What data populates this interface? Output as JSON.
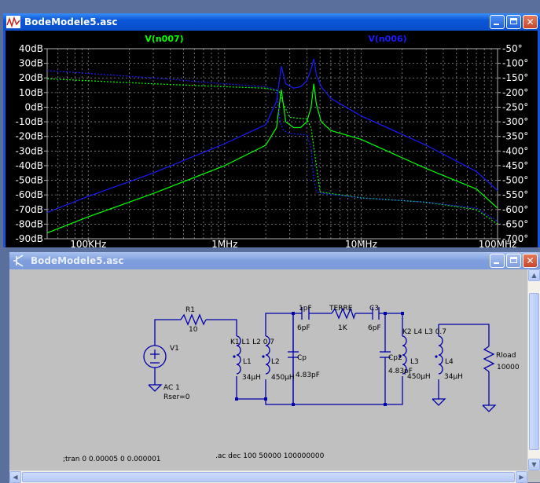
{
  "plot_window": {
    "title": "BodeModele5.asc",
    "trace1_name": "V(n007)",
    "trace2_name": "V(n006)",
    "trace1_color": "#00ff00",
    "trace2_color": "#1a1aff",
    "background": "#000000",
    "left_axis_ticks": [
      "40dB",
      "30dB",
      "20dB",
      "10dB",
      "0dB",
      "-10dB",
      "-20dB",
      "-30dB",
      "-40dB",
      "-50dB",
      "-60dB",
      "-70dB",
      "-80dB",
      "-90dB"
    ],
    "right_axis_ticks": [
      "-50°",
      "-100°",
      "-150°",
      "-200°",
      "-250°",
      "-300°",
      "-350°",
      "-400°",
      "-450°",
      "-500°",
      "-550°",
      "-600°",
      "-650°",
      "-700°"
    ],
    "x_axis_ticks": [
      "100KHz",
      "1MHz",
      "10MHz",
      "100MHz"
    ]
  },
  "chart_data": {
    "type": "line",
    "x_scale": "log",
    "xlim": [
      50000,
      100000000
    ],
    "ylim_left": [
      -90,
      40
    ],
    "ylim_right": [
      -700,
      -50
    ],
    "grid": true,
    "series": [
      {
        "name": "V(n007)",
        "kind": "magnitude",
        "axis": "left",
        "style": "solid",
        "x": [
          50000,
          100000,
          300000,
          1000000,
          2000000,
          2400000,
          2600000,
          2800000,
          3200000,
          3600000,
          4000000,
          4300000,
          4500000,
          4700000,
          5100000,
          6000000,
          10000000,
          30000000,
          70000000,
          100000000
        ],
        "y": [
          -86,
          -75,
          -59,
          -40,
          -26,
          -14,
          12,
          -10,
          -14,
          -14,
          -10,
          0,
          16,
          2,
          -10,
          -16,
          -22,
          -42,
          -56,
          -69
        ]
      },
      {
        "name": "V(n007)",
        "kind": "phase",
        "axis": "right",
        "style": "dashed",
        "x": [
          50000,
          300000,
          1000000,
          2000000,
          2500000,
          2700000,
          3000000,
          4000000,
          4300000,
          4600000,
          5000000,
          10000000,
          30000000,
          70000000,
          100000000
        ],
        "y": [
          -153,
          -170,
          -180,
          -185,
          -195,
          -240,
          -285,
          -290,
          -320,
          -420,
          -540,
          -560,
          -575,
          -600,
          -650
        ]
      },
      {
        "name": "V(n006)",
        "kind": "magnitude",
        "axis": "left",
        "style": "solid",
        "x": [
          50000,
          100000,
          300000,
          1000000,
          2000000,
          2400000,
          2600000,
          2800000,
          3200000,
          3600000,
          4000000,
          4300000,
          4500000,
          4700000,
          5100000,
          6000000,
          10000000,
          30000000,
          70000000,
          100000000
        ],
        "y": [
          -72,
          -61,
          -45,
          -25,
          -12,
          4,
          28,
          16,
          13,
          14,
          18,
          26,
          33,
          22,
          14,
          6,
          -6,
          -26,
          -44,
          -57
        ]
      },
      {
        "name": "V(n006)",
        "kind": "phase",
        "axis": "right",
        "style": "dashed",
        "x": [
          50000,
          300000,
          1000000,
          2000000,
          2400000,
          2550000,
          2700000,
          3000000,
          4000000,
          4300000,
          4500000,
          4700000,
          5200000,
          10000000,
          30000000,
          70000000,
          100000000
        ],
        "y": [
          -125,
          -150,
          -170,
          -180,
          -190,
          -300,
          -330,
          -340,
          -345,
          -390,
          -500,
          -540,
          -545,
          -560,
          -575,
          -595,
          -640
        ]
      }
    ]
  },
  "schematic_window": {
    "title": "BodeModele5.asc",
    "labels": {
      "r1": "R1",
      "r1_value": "10",
      "v1": "V1",
      "v1_ac": "AC 1",
      "v1_rser": "Rser=0",
      "k1": "K1 L1 L2 0.7",
      "l1": "L1",
      "l1_value": "34µH",
      "l2": "L2",
      "l2_value": "450µH",
      "cp_pre": "1pF",
      "cp_pre2": "6pF",
      "cp": "Cp",
      "cp_value": "4.83pF",
      "terre": "TERRE",
      "terre_value": "1K",
      "c3": "C3",
      "c3_value": "6pF",
      "k2": "K2 L4 L3 0.7",
      "cp2": "Cp2",
      "cp2_value": "4.83pF",
      "l3": "L3",
      "l3_value": "450µH",
      "l4": "L4",
      "l4_value": "34µH",
      "rload": "Rload",
      "rload_value": "10000"
    },
    "directive_ac": ".ac dec 100 50000 100000000",
    "directive_tran": ";tran 0 0.00005 0 0.000001"
  }
}
